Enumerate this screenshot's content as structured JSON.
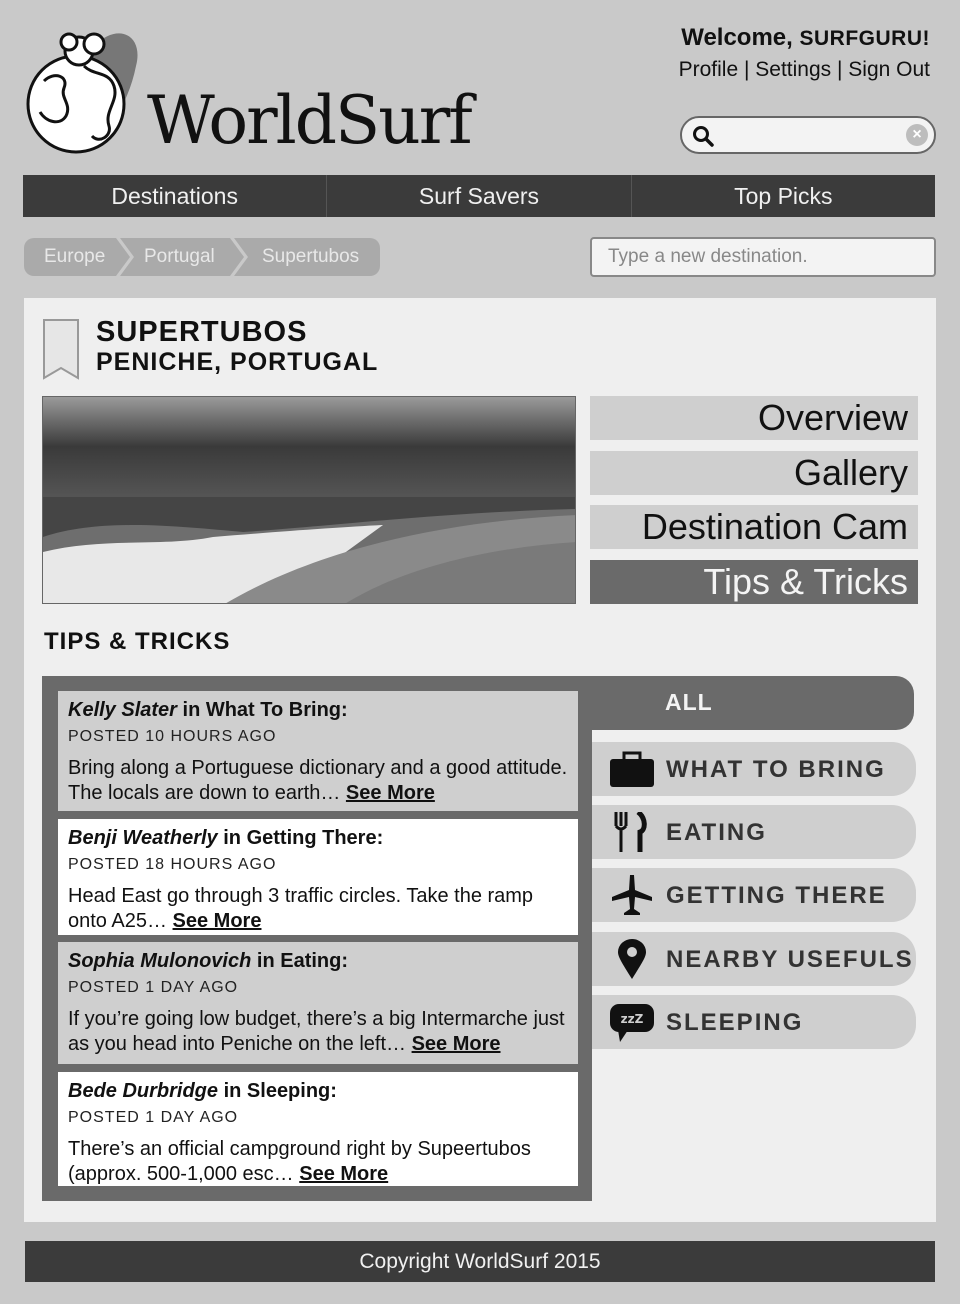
{
  "brand": {
    "name": "WorldSurf"
  },
  "header": {
    "welcome_prefix": "Welcome,",
    "username": "SURFGURU!",
    "links": [
      "Profile",
      "Settings",
      "Sign Out"
    ],
    "search_value": "",
    "search_clear": "×"
  },
  "nav": {
    "items": [
      "Destinations",
      "Surf Savers",
      "Top Picks"
    ]
  },
  "breadcrumb": [
    "Europe",
    "Portugal",
    "Supertubos"
  ],
  "destination_input": {
    "placeholder": "Type a new destination."
  },
  "spot": {
    "name": "SUPERTUBOS",
    "location": "PENICHE, PORTUGAL"
  },
  "side_menu": {
    "items": [
      "Overview",
      "Gallery",
      "Destination Cam",
      "Tips & Tricks"
    ],
    "active": "Tips & Tricks"
  },
  "section_title": "TIPS & TRICKS",
  "tips": [
    {
      "author": "Kelly Slater",
      "category_text": " in What To Bring:",
      "posted": "POSTED 10 HOURS AGO",
      "text": "Bring along a Portuguese dictionary and a good attitude. The locals are down to earth… ",
      "more": "See More"
    },
    {
      "author": "Benji Weatherly",
      "category_text": " in Getting There:",
      "posted": "POSTED 18 HOURS AGO",
      "text": "Head East go through 3 traffic circles. Take the ramp onto A25… ",
      "more": "See More"
    },
    {
      "author": "Sophia Mulonovich",
      "category_text": " in Eating:",
      "posted": "POSTED 1 DAY AGO",
      "text": "If you’re going low budget, there’s a big Intermarche just as you head into Peniche on the left… ",
      "more": "See More"
    },
    {
      "author": "Bede Durbridge",
      "category_text": " in Sleeping:",
      "posted": "POSTED 1 DAY AGO",
      "text": "There’s an official campground right by Supeertubos (approx. 500-1,000 esc… ",
      "more": "See More"
    }
  ],
  "categories": {
    "all": "ALL",
    "items": [
      {
        "label": "WHAT TO BRING",
        "icon": "briefcase-icon"
      },
      {
        "label": "EATING",
        "icon": "fork-knife-icon"
      },
      {
        "label": "GETTING THERE",
        "icon": "airplane-icon"
      },
      {
        "label": "NEARBY USEFULS",
        "icon": "map-pin-icon"
      },
      {
        "label": "SLEEPING",
        "icon": "sleep-bubble-icon",
        "icon_text": "zzZ"
      }
    ]
  },
  "footer": {
    "text": "Copyright WorldSurf 2015"
  }
}
